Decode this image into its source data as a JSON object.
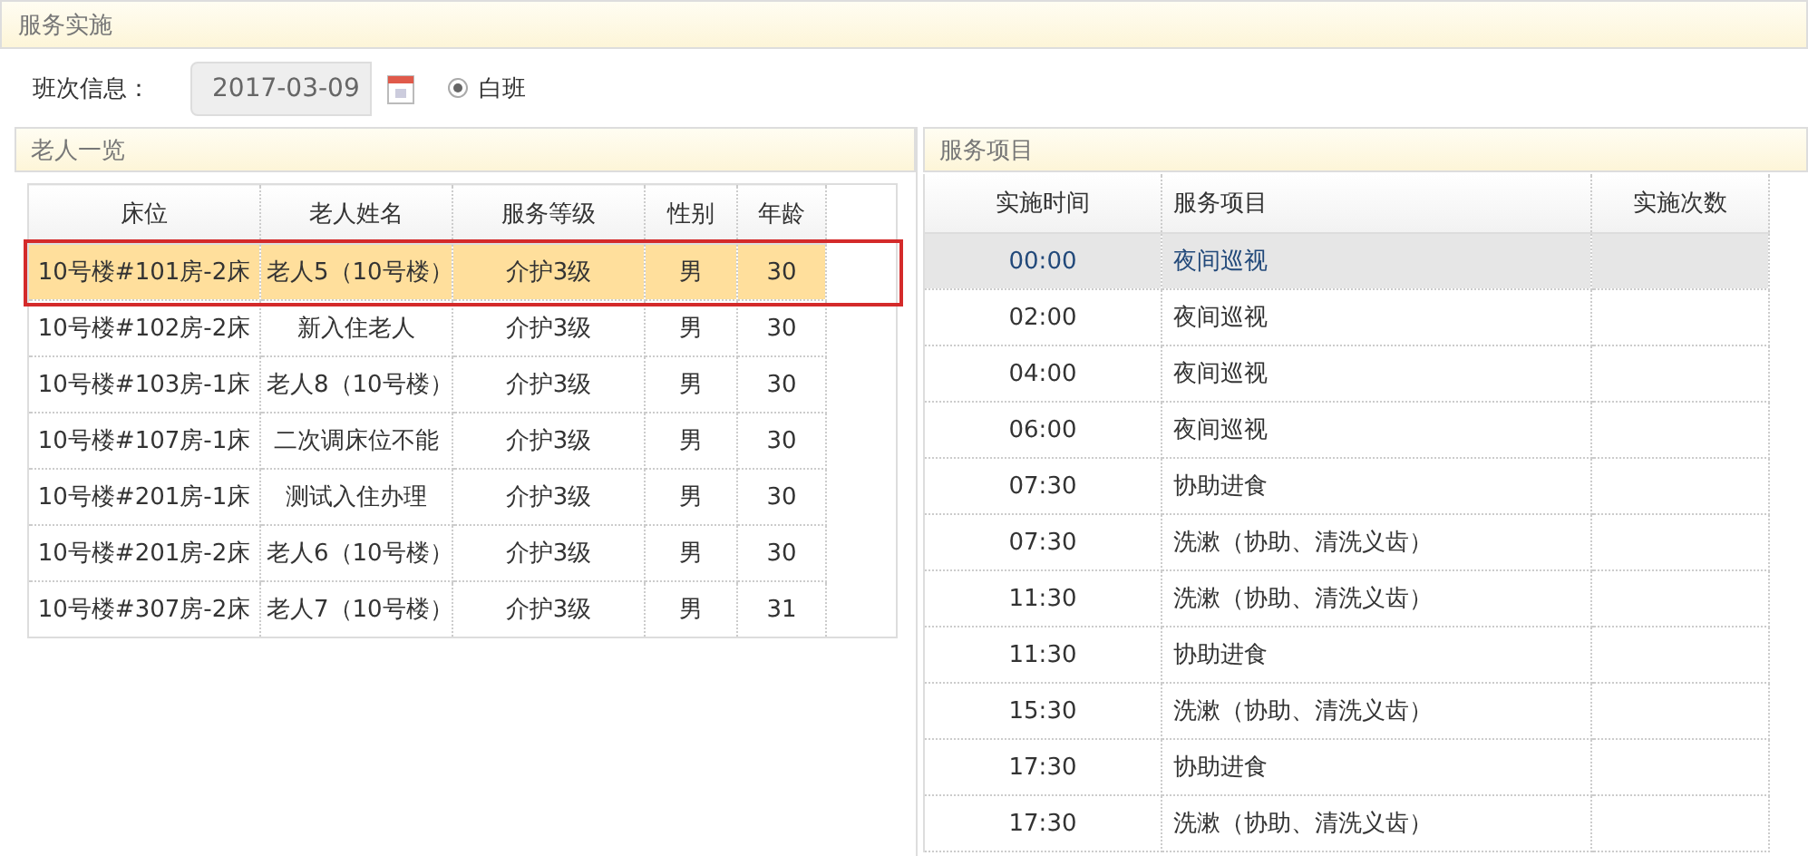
{
  "page_title": "服务实施",
  "shift": {
    "label": "班次信息：",
    "date": "2017-03-09",
    "options": [
      {
        "label": "白班",
        "selected": true
      }
    ]
  },
  "elders": {
    "title": "老人一览",
    "columns": [
      "床位",
      "老人姓名",
      "服务等级",
      "性别",
      "年龄"
    ],
    "rows": [
      {
        "cells": [
          "10号楼#101房-2床",
          "老人5（10号楼）",
          "介护3级",
          "男",
          "30"
        ],
        "selected": true
      },
      {
        "cells": [
          "10号楼#102房-2床",
          "新入住老人",
          "介护3级",
          "男",
          "30"
        ],
        "selected": false
      },
      {
        "cells": [
          "10号楼#103房-1床",
          "老人8（10号楼）",
          "介护3级",
          "男",
          "30"
        ],
        "selected": false
      },
      {
        "cells": [
          "10号楼#107房-1床",
          "二次调床位不能",
          "介护3级",
          "男",
          "30"
        ],
        "selected": false
      },
      {
        "cells": [
          "10号楼#201房-1床",
          "测试入住办理",
          "介护3级",
          "男",
          "30"
        ],
        "selected": false
      },
      {
        "cells": [
          "10号楼#201房-2床",
          "老人6（10号楼）",
          "介护3级",
          "男",
          "30"
        ],
        "selected": false
      },
      {
        "cells": [
          "10号楼#307房-2床",
          "老人7（10号楼）",
          "介护3级",
          "男",
          "31"
        ],
        "selected": false
      }
    ]
  },
  "services": {
    "title": "服务项目",
    "columns": [
      "实施时间",
      "服务项目",
      "实施次数"
    ],
    "rows": [
      {
        "time": "00:00",
        "item": "夜间巡视",
        "selected": true
      },
      {
        "time": "02:00",
        "item": "夜间巡视",
        "selected": false
      },
      {
        "time": "04:00",
        "item": "夜间巡视",
        "selected": false
      },
      {
        "time": "06:00",
        "item": "夜间巡视",
        "selected": false
      },
      {
        "time": "07:30",
        "item": "协助进食",
        "selected": false
      },
      {
        "time": "07:30",
        "item": "洗漱（协助、清洗义齿）",
        "selected": false
      },
      {
        "time": "11:30",
        "item": "洗漱（协助、清洗义齿）",
        "selected": false
      },
      {
        "time": "11:30",
        "item": "协助进食",
        "selected": false
      },
      {
        "time": "15:30",
        "item": "洗漱（协助、清洗义齿）",
        "selected": false
      },
      {
        "time": "17:30",
        "item": "协助进食",
        "selected": false
      },
      {
        "time": "17:30",
        "item": "洗漱（协助、清洗义齿）",
        "selected": false
      }
    ]
  }
}
